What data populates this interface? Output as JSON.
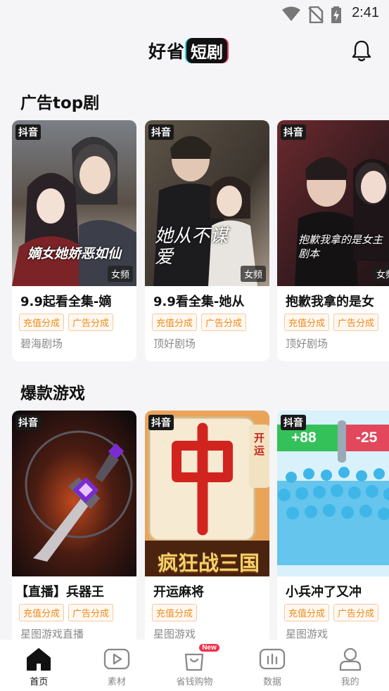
{
  "status_bar": {
    "time": "2:41"
  },
  "header": {
    "logo_part1": "好省",
    "logo_part2": "短剧"
  },
  "sections": [
    {
      "title": "广告top剧",
      "cards": [
        {
          "title": "9.9起看全集-嫡",
          "platform": "抖音",
          "genre": "女频",
          "tags": [
            "充值分成",
            "广告分成"
          ],
          "source": "碧海剧场",
          "poster_text": "嫡女她娇恶如仙"
        },
        {
          "title": "9.9看全集-她从",
          "platform": "抖音",
          "genre": "女频",
          "tags": [
            "充值分成",
            "广告分成"
          ],
          "source": "顶好剧场",
          "poster_text": "她从不谋爱"
        },
        {
          "title": "抱歉我拿的是女",
          "platform": "抖音",
          "genre": "女频",
          "tags": [
            "充值分成",
            "广告分成"
          ],
          "source": "顶好剧场",
          "poster_text": "抱歉我拿的是女主剧本"
        }
      ]
    },
    {
      "title": "爆款游戏",
      "cards": [
        {
          "title": "【直播】兵器王",
          "platform": "抖音",
          "tags": [
            "充值分成",
            "广告分成"
          ],
          "source": "星图游戏直播"
        },
        {
          "title": "开运麻将",
          "platform": "抖音",
          "tags": [
            "充值分成"
          ],
          "source": "星图游戏",
          "poster_text": "疯狂战三国",
          "poster_side_text": "开运"
        },
        {
          "title": "小兵冲了又冲",
          "platform": "抖音",
          "tags": [
            "充值分成",
            "广告分成"
          ],
          "source": "星图游戏",
          "poster_plus": "+88",
          "poster_minus": "-25"
        }
      ]
    }
  ],
  "bottom_nav": {
    "items": [
      {
        "label": "首页",
        "icon": "home-icon",
        "active": true
      },
      {
        "label": "素材",
        "icon": "play-icon",
        "active": false
      },
      {
        "label": "省钱购物",
        "icon": "shopping-bag-icon",
        "active": false,
        "badge": "New"
      },
      {
        "label": "数据",
        "icon": "chart-icon",
        "active": false
      },
      {
        "label": "我的",
        "icon": "user-icon",
        "active": false
      }
    ]
  },
  "colors": {
    "accent_tag": "#f08a1a",
    "new_badge": "#f2304a",
    "background": "#f5f5f7"
  }
}
